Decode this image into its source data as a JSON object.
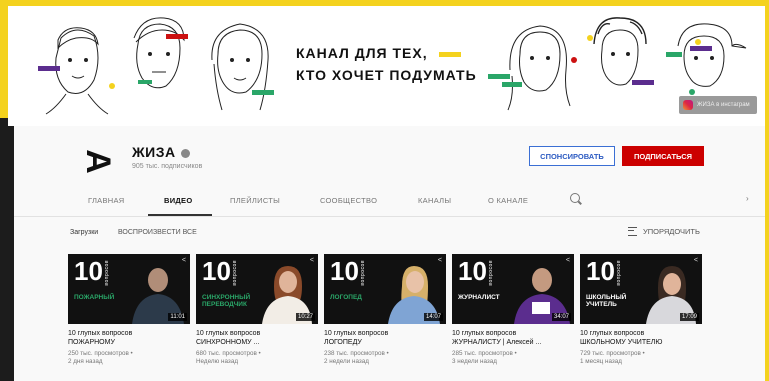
{
  "colors": {
    "frame": "#f4d21e",
    "red": "#cc0000",
    "accent_blue": "#2c5bc2",
    "green": "#2aa668"
  },
  "banner": {
    "tagline_line1": "КАНАЛ ДЛЯ ТЕХ,",
    "tagline_line2": "КТО ХОЧЕТ ПОДУМАТЬ",
    "instagram_label": "ЖИЗА в инстаграм"
  },
  "channel": {
    "logo_glyph": "А",
    "name": "ЖИЗА",
    "subscribers": "905 тыс. подписчиков",
    "sponsor_label": "СПОНСИРОВАТЬ",
    "subscribe_label": "ПОДПИСАТЬСЯ"
  },
  "tabs": [
    {
      "label": "ГЛАВНАЯ"
    },
    {
      "label": "ВИДЕО"
    },
    {
      "label": "ПЛЕЙЛИСТЫ"
    },
    {
      "label": "СООБЩЕСТВО"
    },
    {
      "label": "КАНАЛЫ"
    },
    {
      "label": "О КАНАЛЕ"
    }
  ],
  "filters": {
    "uploads": "Загрузки",
    "play_all": "ВОСПРОИЗВЕСТИ ВСЕ",
    "sort": "УПОРЯДОЧИТЬ"
  },
  "videos": [
    {
      "num": "10",
      "vertical": "вопросов",
      "role": "ПОЖАРНЫЙ",
      "role_color": "#2aa668",
      "duration": "11:01",
      "title": "10 глупых вопросов",
      "title2": "ПОЖАРНОМУ",
      "views": "250 тыс. просмотров •",
      "age": "2 дня назад"
    },
    {
      "num": "10",
      "vertical": "вопросов",
      "role": "СИНХРОННЫЙ ПЕРЕВОДЧИК",
      "role_color": "#2aa668",
      "duration": "10:27",
      "title": "10 глупых вопросов",
      "title2": "СИНХРОННОМУ ...",
      "views": "680 тыс. просмотров •",
      "age": "Неделю назад"
    },
    {
      "num": "10",
      "vertical": "вопросов",
      "role": "ЛОГОПЕД",
      "role_color": "#2aa668",
      "duration": "14:07",
      "title": "10 глупых вопросов",
      "title2": "ЛОГОПЕДУ",
      "views": "238 тыс. просмотров •",
      "age": "2 недели назад"
    },
    {
      "num": "10",
      "vertical": "вопросов",
      "role": "ЖУРНАЛИСТ",
      "role_color": "#ffffff",
      "duration": "34:07",
      "title": "10 глупых вопросов",
      "title2": "ЖУРНАЛИСТУ | Алексей ...",
      "views": "285 тыс. просмотров •",
      "age": "3 недели назад"
    },
    {
      "num": "10",
      "vertical": "вопросов",
      "role": "ШКОЛЬНЫЙ УЧИТЕЛЬ",
      "role_color": "#ffffff",
      "duration": "17:09",
      "title": "10 глупых вопросов",
      "title2": "ШКОЛЬНОМУ УЧИТЕЛЮ",
      "views": "729 тыс. просмотров •",
      "age": "1 месяц назад"
    }
  ]
}
